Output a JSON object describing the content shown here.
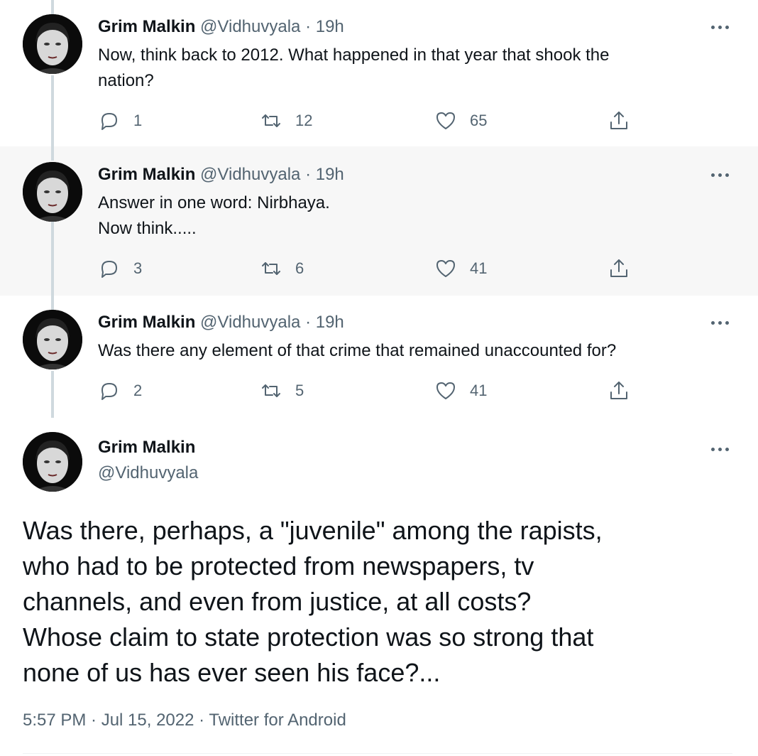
{
  "thread": [
    {
      "name": "Grim Malkin",
      "handle": "@Vidhuvyala",
      "sep": "·",
      "time": "19h",
      "lines": [
        "Now, think back to 2012. What happened in that year that shook the",
        "nation?"
      ],
      "replies": "1",
      "retweets": "12",
      "likes": "65"
    },
    {
      "name": "Grim Malkin",
      "handle": "@Vidhuvyala",
      "sep": "·",
      "time": "19h",
      "lines": [
        "Answer in one word: Nirbhaya.",
        "Now think....."
      ],
      "replies": "3",
      "retweets": "6",
      "likes": "41"
    },
    {
      "name": "Grim Malkin",
      "handle": "@Vidhuvyala",
      "sep": "·",
      "time": "19h",
      "lines": [
        "Was there any element of that crime that remained unaccounted for?"
      ],
      "replies": "2",
      "retweets": "5",
      "likes": "41"
    }
  ],
  "main_tweet": {
    "name": "Grim Malkin",
    "handle": "@Vidhuvyala",
    "lines": [
      "Was there, perhaps, a \"juvenile\" among the rapists,",
      "who had to be protected from newspapers, tv",
      "channels, and even from justice, at all costs?",
      "Whose claim to state protection was so strong that",
      "none of us has ever seen his face?..."
    ],
    "meta": "5:57 PM · Jul 15, 2022 · Twitter for Android"
  },
  "icons": {
    "more": "more-dots-icon",
    "reply": "reply-icon",
    "retweet": "retweet-icon",
    "like": "heart-icon",
    "share": "share-icon"
  },
  "colors": {
    "text": "#0f1419",
    "secondary": "#536471",
    "thread_line": "#cfd9de",
    "highlight_bg": "#f7f7f7"
  }
}
